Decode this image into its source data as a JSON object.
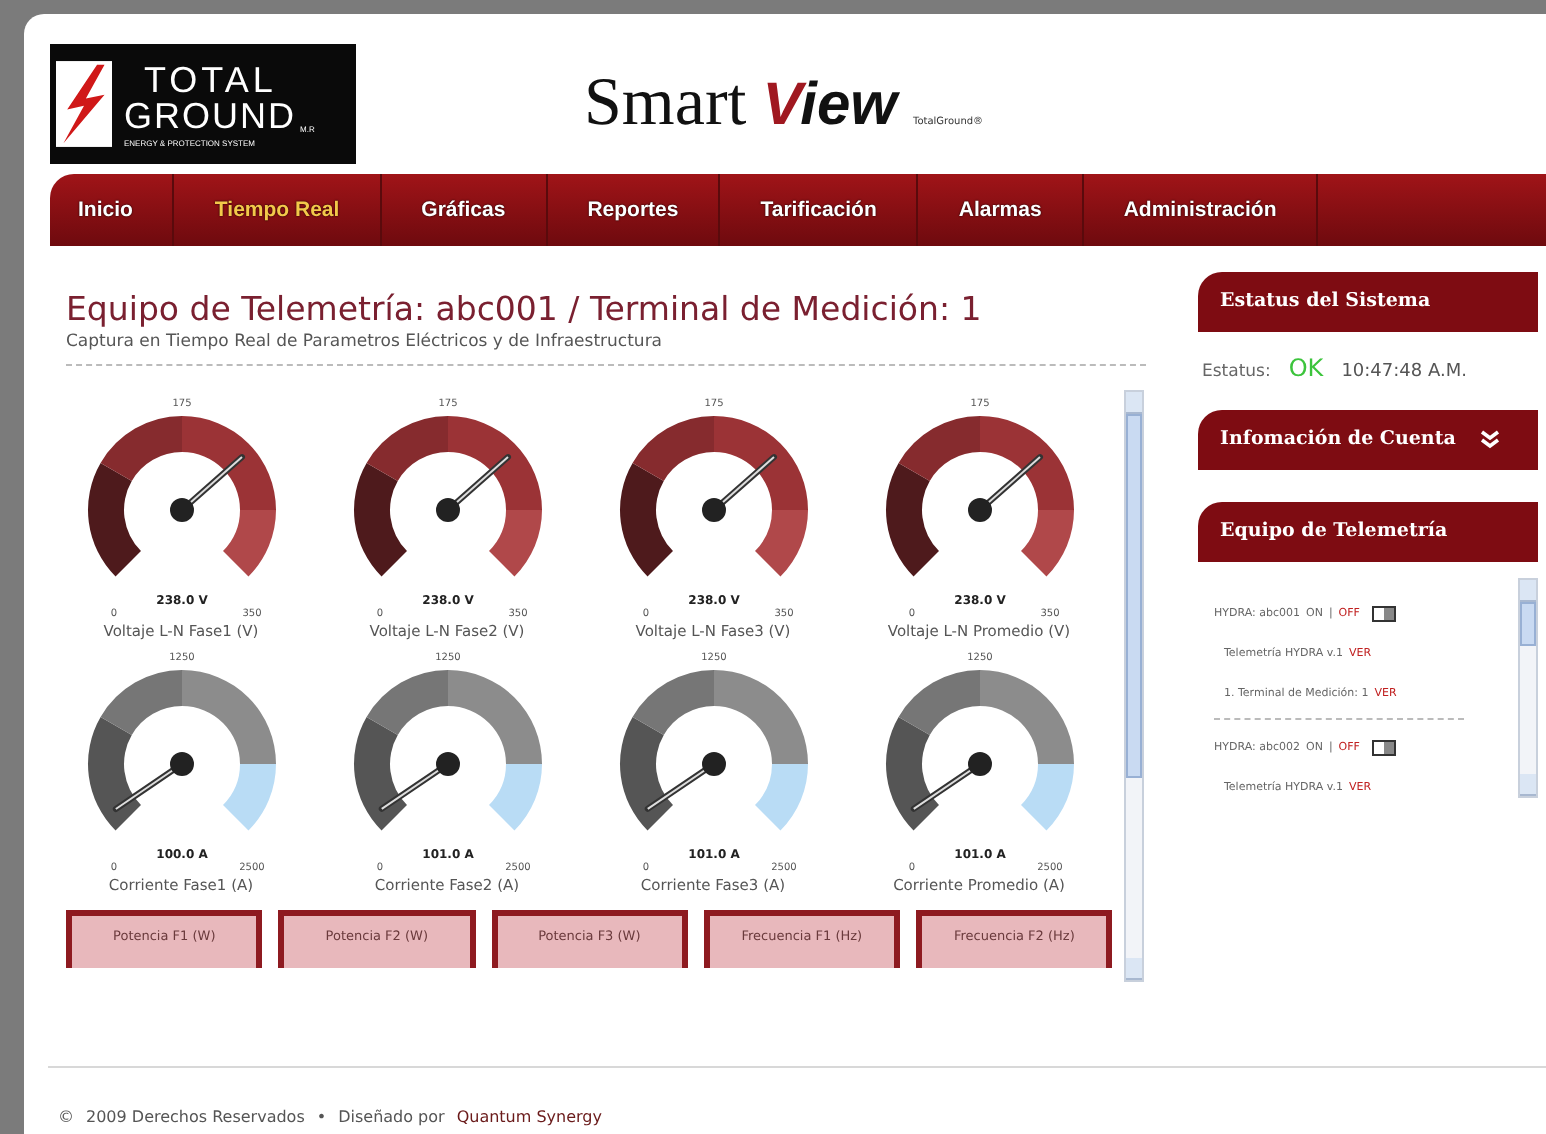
{
  "logo": {
    "line1": "TOTAL",
    "line2": "GROUND",
    "mark": "M.R",
    "tagline": "ENERGY & PROTECTION SYSTEM"
  },
  "brand": {
    "word1": "Smart",
    "word2": "View",
    "note": "TotalGround®"
  },
  "nav": [
    {
      "label": "Inicio",
      "selected": false
    },
    {
      "label": "Tiempo Real",
      "selected": true
    },
    {
      "label": "Gráficas",
      "selected": false
    },
    {
      "label": "Reportes",
      "selected": false
    },
    {
      "label": "Tarificación",
      "selected": false
    },
    {
      "label": "Alarmas",
      "selected": false
    },
    {
      "label": "Administración",
      "selected": false
    }
  ],
  "heading": {
    "title": "Equipo de Telemetría: abc001 / Terminal de Medición: 1",
    "subtitle": "Captura en Tiempo Real de Parametros Eléctricos y de Infraestructura"
  },
  "gauges": [
    {
      "kind": "voltage",
      "label": "Voltaje L-N Fase1 (V)",
      "min": "0",
      "mid": "175",
      "max": "350",
      "reading": "238.0 V"
    },
    {
      "kind": "voltage",
      "label": "Voltaje L-N Fase2 (V)",
      "min": "0",
      "mid": "175",
      "max": "350",
      "reading": "238.0 V"
    },
    {
      "kind": "voltage",
      "label": "Voltaje L-N Fase3 (V)",
      "min": "0",
      "mid": "175",
      "max": "350",
      "reading": "238.0 V"
    },
    {
      "kind": "voltage",
      "label": "Voltaje L-N Promedio (V)",
      "min": "0",
      "mid": "175",
      "max": "350",
      "reading": "238.0 V"
    },
    {
      "kind": "current",
      "label": "Corriente Fase1 (A)",
      "min": "0",
      "mid": "1250",
      "max": "2500",
      "reading": "100.0 A"
    },
    {
      "kind": "current",
      "label": "Corriente Fase2 (A)",
      "min": "0",
      "mid": "1250",
      "max": "2500",
      "reading": "101.0 A"
    },
    {
      "kind": "current",
      "label": "Corriente Fase3 (A)",
      "min": "0",
      "mid": "1250",
      "max": "2500",
      "reading": "101.0 A"
    },
    {
      "kind": "current",
      "label": "Corriente Promedio (A)",
      "min": "0",
      "mid": "1250",
      "max": "2500",
      "reading": "101.0 A"
    }
  ],
  "panels": [
    "Potencia F1 (W)",
    "Potencia F2 (W)",
    "Potencia F3 (W)",
    "Frecuencia F1 (Hz)",
    "Frecuencia F2 (Hz)"
  ],
  "sidebar": {
    "status": {
      "title": "Estatus del Sistema",
      "label": "Estatus:",
      "value": "OK",
      "time": "10:47:48 A.M."
    },
    "account": {
      "title": "Infomación de Cuenta",
      "expanded": false
    },
    "devices": {
      "title": "Equipo de Telemetría",
      "items": [
        {
          "name": "HYDRA: abc001",
          "on": "ON",
          "sep": "|",
          "off": "OFF",
          "children": [
            {
              "label": "Telemetría HYDRA v.1",
              "link": "VER"
            },
            {
              "label": "1. Terminal de Medición: 1",
              "link": "VER"
            }
          ]
        },
        {
          "name": "HYDRA: abc002",
          "on": "ON",
          "sep": "|",
          "off": "OFF",
          "children": [
            {
              "label": "Telemetría HYDRA v.1",
              "link": "VER"
            }
          ]
        }
      ]
    }
  },
  "footer": {
    "copyright": "©",
    "text": "2009 Derechos Reservados",
    "sep": "•",
    "designed": "Diseñado por",
    "author": "Quantum Synergy"
  }
}
